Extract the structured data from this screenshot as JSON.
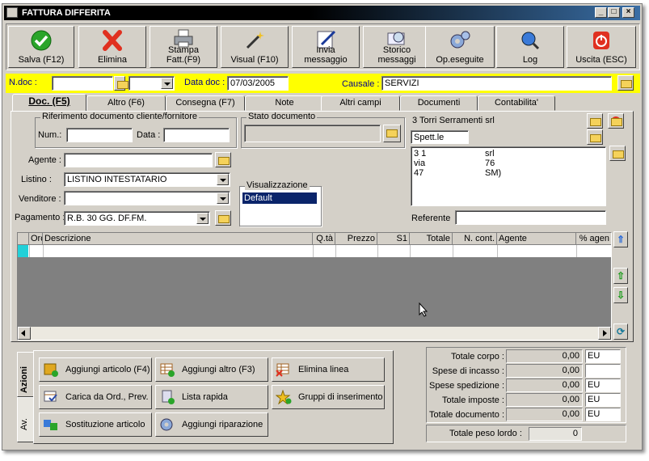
{
  "window": {
    "title": "FATTURA DIFFERITA",
    "min": "_",
    "max": "□",
    "close": "×"
  },
  "toolbar": [
    {
      "label": "Salva (F12)",
      "icon": "check-icon",
      "color": "#2aa52a"
    },
    {
      "label": "Elimina",
      "icon": "x-icon",
      "color": "#e03020"
    },
    {
      "label": "Stampa\nFatt.(F9)",
      "icon": "printer-icon"
    },
    {
      "label": "Visual (F10)",
      "icon": "magic-wand-icon"
    },
    {
      "label": "Invia\nmessaggio",
      "icon": "pen-paper-icon"
    },
    {
      "label": "Storico\nmessaggi",
      "icon": "magnifier-icon"
    },
    {
      "label": "Op.eseguite",
      "icon": "gear-icon"
    },
    {
      "label": "Log",
      "icon": "search-log-icon"
    },
    {
      "label": "Uscita (ESC)",
      "icon": "power-icon",
      "color": "#e03020"
    }
  ],
  "header": {
    "ndoc_label": "N.doc :",
    "ndoc_value": "",
    "data_label": "Data doc :",
    "data_value": "07/03/2005",
    "causale_label": "Causale :",
    "causale_value": "SERVIZI"
  },
  "tabs": [
    "Doc. (F5)",
    "Altro (F6)",
    "Consegna (F7)",
    "Note",
    "Altri campi",
    "Documenti",
    "Contabilita'"
  ],
  "rif": {
    "title": "Riferimento documento cliente/fornitore",
    "num_label": "Num.:",
    "num_value": "",
    "data_label": "Data :",
    "data_value": ""
  },
  "stato": {
    "title": "Stato documento",
    "value": ""
  },
  "fields": {
    "agente_label": "Agente :",
    "agente_value": "",
    "listino_label": "Listino :",
    "listino_value": "LISTINO INTESTATARIO",
    "venditore_label": "Venditore :",
    "venditore_value": "",
    "pagamento_label": "Pagamento :",
    "pagamento_value": "R.B. 30 GG. DF.FM."
  },
  "visualizzazione": {
    "title": "Visualizzazione",
    "item": "Default"
  },
  "cliente": {
    "name": "3 Torri Serramenti srl",
    "spett": "Spett.le",
    "lines": [
      [
        "3 1",
        "srl"
      ],
      [
        "via",
        "76"
      ],
      [
        "47",
        "SM)"
      ]
    ],
    "referente_label": "Referente",
    "referente_value": ""
  },
  "grid": {
    "columns": [
      "Ord",
      "Descrizione",
      "Q.tà",
      "Prezzo",
      "S1",
      "Totale",
      "N. cont.",
      "Agente",
      "% agen"
    ]
  },
  "vtabs": [
    "Azioni",
    "Av."
  ],
  "actions": [
    {
      "label": "Aggiungi articolo (F4)",
      "icon": "box-add-icon"
    },
    {
      "label": "Aggiungi altro (F3)",
      "icon": "grid-add-icon"
    },
    {
      "label": "Elimina linea",
      "icon": "grid-delete-icon"
    },
    {
      "label": "Carica da Ord., Prev.",
      "icon": "document-check-icon"
    },
    {
      "label": "Lista rapida",
      "icon": "list-add-icon"
    },
    {
      "label": "Gruppi di inserimento",
      "icon": "star-add-icon"
    },
    {
      "label": "Sostituzione articolo",
      "icon": "swap-icon"
    },
    {
      "label": "Aggiungi riparazione",
      "icon": "gear-add-icon"
    }
  ],
  "totals": [
    {
      "label": "Totale corpo :",
      "value": "0,00",
      "cur": "EU"
    },
    {
      "label": "Spese di incasso :",
      "value": "0,00",
      "cur": ""
    },
    {
      "label": "Spese spedizione :",
      "value": "0,00",
      "cur": "EU"
    },
    {
      "label": "Totale imposte :",
      "value": "0,00",
      "cur": "EU"
    },
    {
      "label": "Totale documento :",
      "value": "0,00",
      "cur": "EU"
    }
  ],
  "peso": {
    "label": "Totale peso lordo :",
    "value": "0"
  }
}
